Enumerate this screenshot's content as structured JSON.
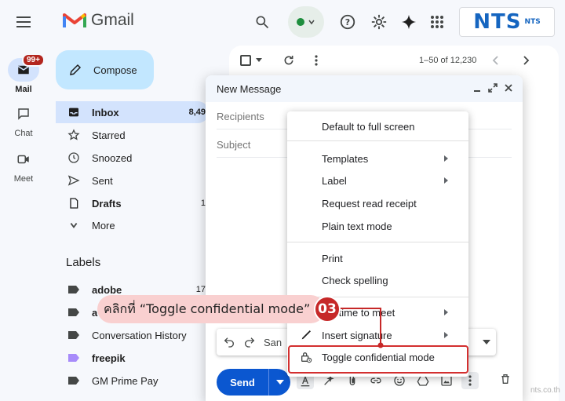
{
  "header": {
    "app_name": "Gmail"
  },
  "rail": {
    "mail_label": "Mail",
    "mail_badge": "99+",
    "chat_label": "Chat",
    "meet_label": "Meet"
  },
  "brand": {
    "logo_big": "NTS",
    "logo_small": "NTS"
  },
  "sidebar": {
    "compose_label": "Compose",
    "items": [
      {
        "label": "Inbox",
        "count": "8,49"
      },
      {
        "label": "Starred",
        "count": ""
      },
      {
        "label": "Snoozed",
        "count": ""
      },
      {
        "label": "Sent",
        "count": ""
      },
      {
        "label": "Drafts",
        "count": "1"
      },
      {
        "label": "More",
        "count": ""
      }
    ],
    "labels_heading": "Labels",
    "labels": [
      {
        "label": "adobe",
        "count": "17",
        "color": "#444746"
      },
      {
        "label": "a",
        "count": "",
        "color": "#444746"
      },
      {
        "label": "Conversation History",
        "count": "",
        "color": "#444746"
      },
      {
        "label": "freepik",
        "count": "",
        "color": "#a78bfa"
      },
      {
        "label": "GM Prime Pay",
        "count": "",
        "color": "#444746"
      }
    ]
  },
  "mail_list": {
    "pagination": "1–50 of 12,230"
  },
  "compose_window": {
    "title": "New Message",
    "recipients_placeholder": "Recipients",
    "subject_placeholder": "Subject",
    "font_name": "San",
    "send_label": "Send"
  },
  "context_menu": {
    "items": [
      {
        "label": "Default to full screen",
        "submenu": false
      },
      {
        "label": "Templates",
        "submenu": true
      },
      {
        "label": "Label",
        "submenu": true
      },
      {
        "label": "Request read receipt",
        "submenu": false
      },
      {
        "label": "Plain text mode",
        "submenu": false
      },
      {
        "label": "Print",
        "submenu": false
      },
      {
        "label": "Check spelling",
        "submenu": false
      },
      {
        "label": "p a time to meet",
        "submenu": true
      },
      {
        "label": "Insert signature",
        "submenu": true
      },
      {
        "label": "Toggle confidential mode",
        "submenu": false
      }
    ]
  },
  "annotation": {
    "instruction": "คลิกที่ “Toggle confidential mode”",
    "step_number": "03",
    "accent_color": "#c62828"
  },
  "watermark": "nts.co.th"
}
